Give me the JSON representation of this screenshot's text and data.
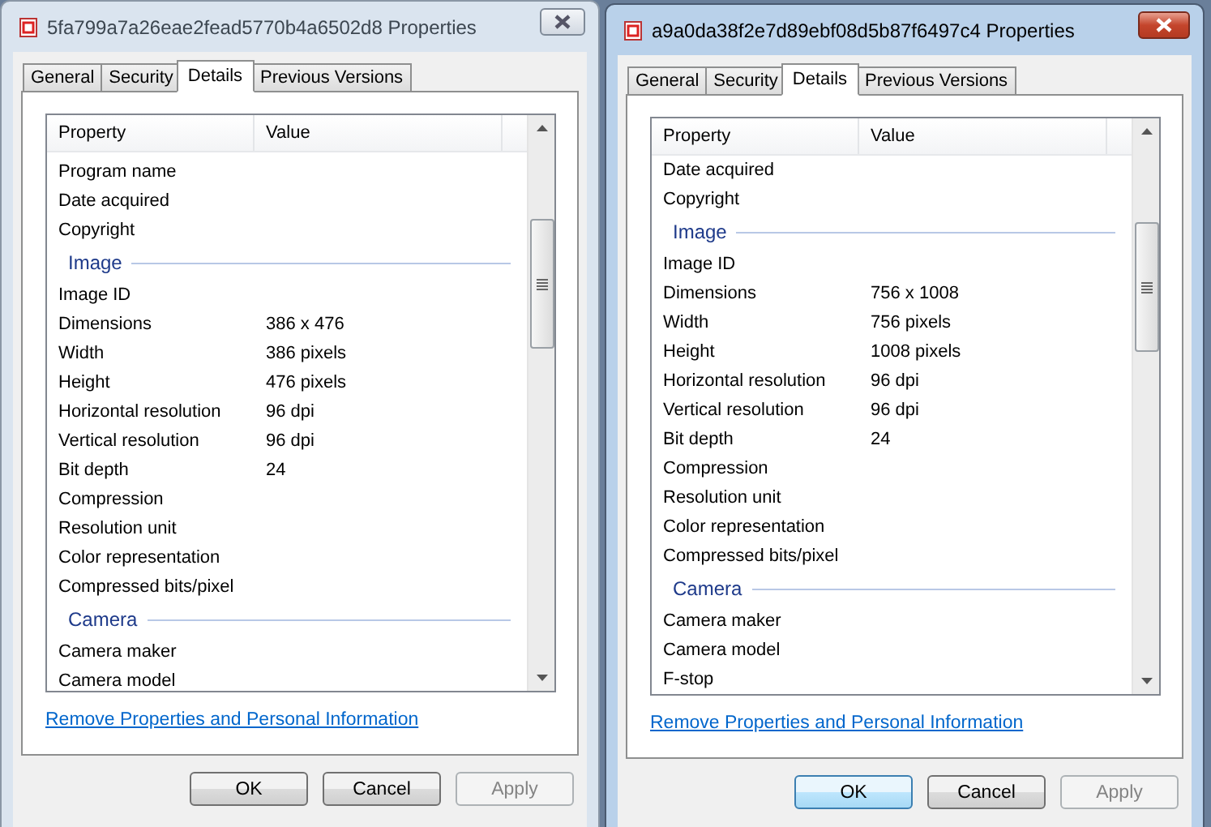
{
  "windows": [
    {
      "title": "5fa799a7a26eae2fead5770b4a6502d8 Properties",
      "active": false,
      "tabs": [
        {
          "label": "General",
          "selected": false
        },
        {
          "label": "Security",
          "selected": false
        },
        {
          "label": "Details",
          "selected": true
        },
        {
          "label": "Previous Versions",
          "selected": false
        }
      ],
      "columns": [
        "Property",
        "Value"
      ],
      "rows": [
        {
          "kind": "item",
          "property": "Program name"
        },
        {
          "kind": "item",
          "property": "Date acquired"
        },
        {
          "kind": "item",
          "property": "Copyright"
        },
        {
          "kind": "group",
          "property": "Image"
        },
        {
          "kind": "item",
          "property": "Image ID"
        },
        {
          "kind": "item",
          "property": "Dimensions",
          "value": "386 x 476"
        },
        {
          "kind": "item",
          "property": "Width",
          "value": "386 pixels"
        },
        {
          "kind": "item",
          "property": "Height",
          "value": "476 pixels"
        },
        {
          "kind": "item",
          "property": "Horizontal resolution",
          "value": "96 dpi"
        },
        {
          "kind": "item",
          "property": "Vertical resolution",
          "value": "96 dpi"
        },
        {
          "kind": "item",
          "property": "Bit depth",
          "value": "24"
        },
        {
          "kind": "item",
          "property": "Compression"
        },
        {
          "kind": "item",
          "property": "Resolution unit"
        },
        {
          "kind": "item",
          "property": "Color representation"
        },
        {
          "kind": "item",
          "property": "Compressed bits/pixel"
        },
        {
          "kind": "group",
          "property": "Camera"
        },
        {
          "kind": "item",
          "property": "Camera maker"
        },
        {
          "kind": "item",
          "property": "Camera model"
        }
      ],
      "link": "Remove Properties and Personal Information",
      "buttons": [
        {
          "label": "OK",
          "default": false,
          "disabled": false
        },
        {
          "label": "Cancel",
          "default": false,
          "disabled": false
        },
        {
          "label": "Apply",
          "default": false,
          "disabled": true
        }
      ]
    },
    {
      "title": "a9a0da38f2e7d89ebf08d5b87f6497c4 Properties",
      "active": true,
      "tabs": [
        {
          "label": "General",
          "selected": false
        },
        {
          "label": "Security",
          "selected": false
        },
        {
          "label": "Details",
          "selected": true
        },
        {
          "label": "Previous Versions",
          "selected": false
        }
      ],
      "columns": [
        "Property",
        "Value"
      ],
      "rows": [
        {
          "kind": "item",
          "property": "Date acquired"
        },
        {
          "kind": "item",
          "property": "Copyright"
        },
        {
          "kind": "group",
          "property": "Image"
        },
        {
          "kind": "item",
          "property": "Image ID"
        },
        {
          "kind": "item",
          "property": "Dimensions",
          "value": "756 x 1008"
        },
        {
          "kind": "item",
          "property": "Width",
          "value": "756 pixels"
        },
        {
          "kind": "item",
          "property": "Height",
          "value": "1008 pixels"
        },
        {
          "kind": "item",
          "property": "Horizontal resolution",
          "value": "96 dpi"
        },
        {
          "kind": "item",
          "property": "Vertical resolution",
          "value": "96 dpi"
        },
        {
          "kind": "item",
          "property": "Bit depth",
          "value": "24"
        },
        {
          "kind": "item",
          "property": "Compression"
        },
        {
          "kind": "item",
          "property": "Resolution unit"
        },
        {
          "kind": "item",
          "property": "Color representation"
        },
        {
          "kind": "item",
          "property": "Compressed bits/pixel"
        },
        {
          "kind": "group",
          "property": "Camera"
        },
        {
          "kind": "item",
          "property": "Camera maker"
        },
        {
          "kind": "item",
          "property": "Camera model"
        },
        {
          "kind": "item",
          "property": "F-stop"
        }
      ],
      "link": "Remove Properties and Personal Information",
      "buttons": [
        {
          "label": "OK",
          "default": true,
          "disabled": false
        },
        {
          "label": "Cancel",
          "default": false,
          "disabled": false
        },
        {
          "label": "Apply",
          "default": false,
          "disabled": true
        }
      ]
    }
  ]
}
